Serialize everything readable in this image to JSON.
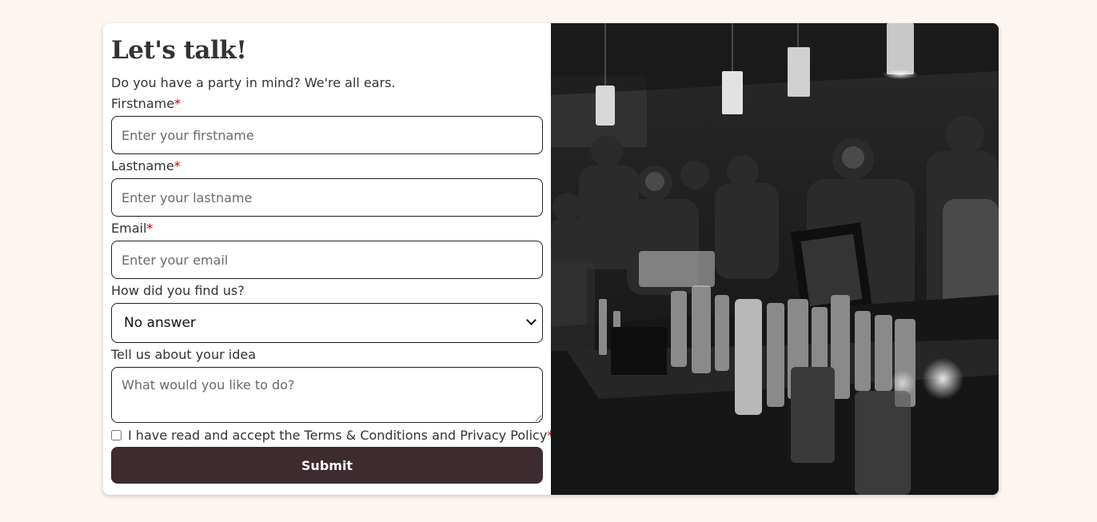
{
  "form": {
    "title": "Let's talk!",
    "subtitle": "Do you have a party in mind? We're all ears.",
    "required_marker": "*",
    "firstname": {
      "label": "Firstname",
      "placeholder": "Enter your firstname"
    },
    "lastname": {
      "label": "Lastname",
      "placeholder": "Enter your lastname"
    },
    "email": {
      "label": "Email",
      "placeholder": "Enter your email"
    },
    "source": {
      "label": "How did you find us?",
      "selected": "No answer"
    },
    "idea": {
      "label": "Tell us about your idea",
      "placeholder": "What would you like to do?"
    },
    "terms": {
      "label": "I have read and accept the Terms & Conditions and Privacy Policy"
    },
    "submit_label": "Submit"
  },
  "image": {
    "subject": "black and white photo of a crowded bar with bottles on the counter and hanging pendant lights"
  },
  "colors": {
    "page_background": "#fdf6f0",
    "button": "#3d2b2f",
    "required": "#d40000"
  }
}
